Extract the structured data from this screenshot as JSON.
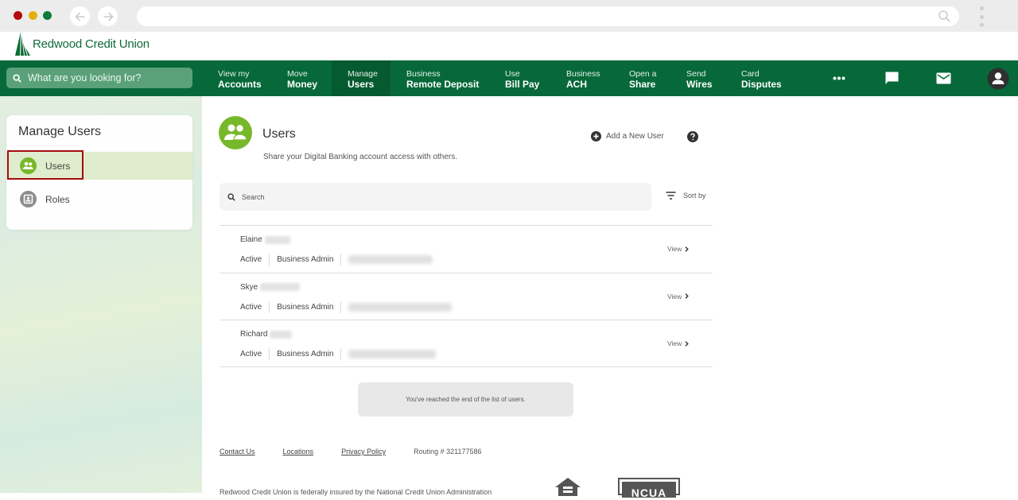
{
  "browser": {
    "back_icon": "arrow-left-icon",
    "forward_icon": "arrow-right-icon",
    "url": ""
  },
  "brand": {
    "name": "Redwood Credit Union",
    "primary_color": "#07693a",
    "accent_color": "#76b82a"
  },
  "global_search": {
    "placeholder": "What are you looking for?"
  },
  "nav": {
    "items": [
      {
        "line1": "View my",
        "line2": "Accounts"
      },
      {
        "line1": "Move",
        "line2": "Money"
      },
      {
        "line1": "Manage",
        "line2": "Users",
        "active": true
      },
      {
        "line1": "Business",
        "line2": "Remote Deposit"
      },
      {
        "line1": "Use",
        "line2": "Bill Pay"
      },
      {
        "line1": "Business",
        "line2": "ACH"
      },
      {
        "line1": "Open a",
        "line2": "Share"
      },
      {
        "line1": "Send",
        "line2": "Wires"
      },
      {
        "line1": "Card",
        "line2": "Disputes"
      }
    ],
    "icons": [
      "more-icon",
      "chat-icon",
      "mail-icon",
      "profile-icon"
    ]
  },
  "sidebar": {
    "title": "Manage Users",
    "items": [
      {
        "label": "Users",
        "icon": "users-icon",
        "selected": true
      },
      {
        "label": "Roles",
        "icon": "roles-icon",
        "selected": false
      }
    ]
  },
  "main": {
    "title": "Users",
    "subtitle": "Share your Digital Banking account access with others.",
    "add_user_label": "Add a New User",
    "search_placeholder": "Search",
    "sort_label": "Sort by",
    "view_label": "View",
    "users": [
      {
        "first_name": "Elaine",
        "status": "Active",
        "role": "Business Admin"
      },
      {
        "first_name": "Skye",
        "status": "Active",
        "role": "Business Admin"
      },
      {
        "first_name": "Richard",
        "status": "Active",
        "role": "Business Admin"
      }
    ],
    "end_notice": "You've reached the end of the list of users."
  },
  "footer": {
    "links": [
      "Contact Us",
      "Locations",
      "Privacy Policy"
    ],
    "routing": "Routing # 321177586",
    "disclaimer": "Redwood Credit Union is federally insured by the National Credit Union Administration",
    "ncua_label": "NCUA"
  }
}
